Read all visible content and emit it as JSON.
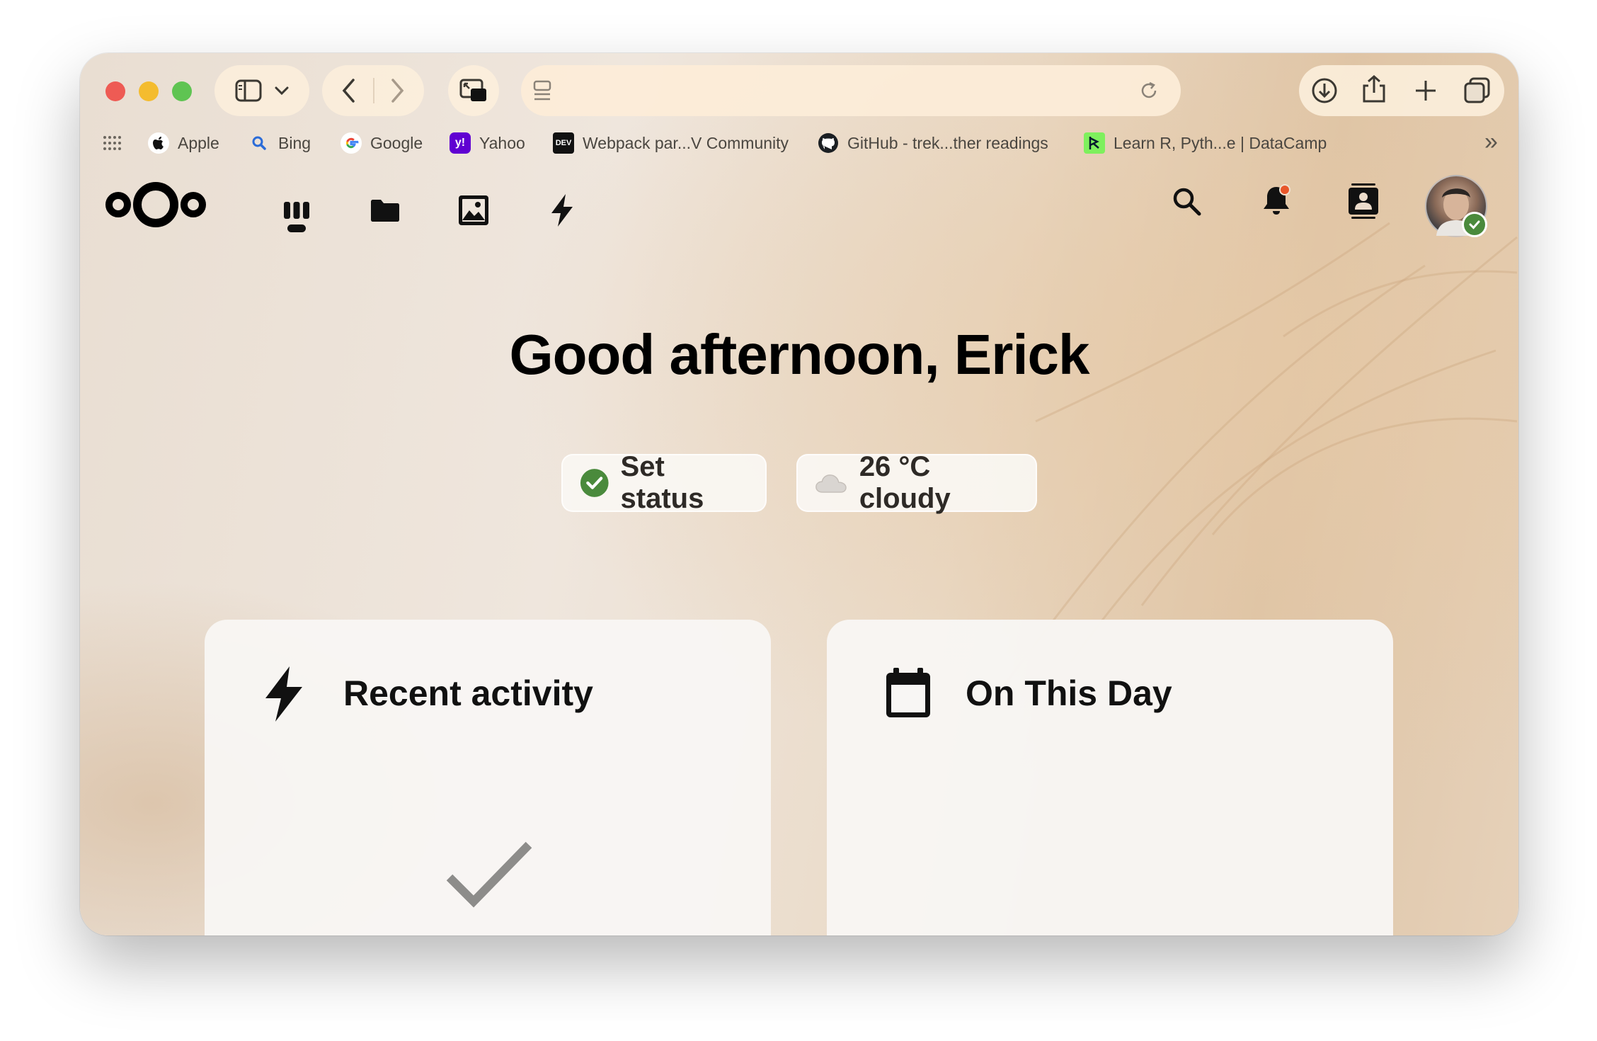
{
  "browser": {
    "bookmarks": [
      {
        "label": "Apple",
        "icon": "apple-icon"
      },
      {
        "label": "Bing",
        "icon": "bing-search-icon"
      },
      {
        "label": "Google",
        "icon": "google-icon"
      },
      {
        "label": "Yahoo",
        "icon": "yahoo-icon",
        "icon_text": "y!"
      },
      {
        "label": "Webpack par...V Community",
        "icon": "dev-icon",
        "icon_text": "DEV"
      },
      {
        "label": "GitHub - trek...ther readings",
        "icon": "github-icon"
      },
      {
        "label": "Learn R, Pyth...e | DataCamp",
        "icon": "datacamp-icon"
      }
    ],
    "more_bookmarks_glyph": "»"
  },
  "nextcloud": {
    "greeting": "Good afternoon, Erick",
    "status_button": "Set status",
    "weather": "26 °C cloudy",
    "nav": [
      "dashboard-icon",
      "files-icon",
      "photos-icon",
      "activity-icon"
    ],
    "header_right": [
      "search-icon",
      "notifications-icon",
      "contacts-icon",
      "avatar"
    ],
    "panels": [
      {
        "title": "Recent activity",
        "icon": "lightning-icon"
      },
      {
        "title": "On This Day",
        "icon": "calendar-icon"
      }
    ]
  },
  "colors": {
    "accent_green": "#4a8a3c",
    "notification_dot": "#e8562a"
  }
}
